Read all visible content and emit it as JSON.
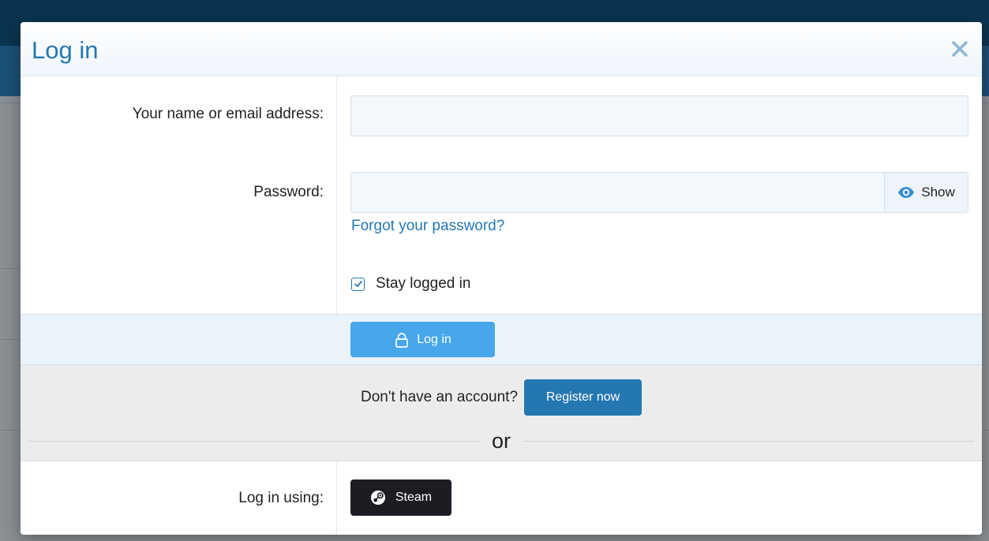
{
  "modal": {
    "title": "Log in",
    "close_icon": "close-icon"
  },
  "form": {
    "username_label": "Your name or email address:",
    "username_value": "",
    "username_placeholder": "",
    "password_label": "Password:",
    "password_value": "",
    "password_placeholder": "",
    "show_label": "Show",
    "show_icon": "eye-icon",
    "forgot_label": "Forgot your password?",
    "stay_logged_in_label": "Stay logged in",
    "stay_logged_in_checked": true
  },
  "submit": {
    "login_label": "Log in",
    "login_icon": "lock-icon"
  },
  "register": {
    "prompt": "Don't have an account?",
    "button_label": "Register now",
    "or_text": "or"
  },
  "social": {
    "label": "Log in using:",
    "steam_label": "Steam",
    "steam_icon": "steam-icon"
  },
  "colors": {
    "accent": "#2577b1",
    "login_button": "#47a7eb",
    "steam_button": "#1b1d22",
    "topbar": "#0b3450"
  }
}
